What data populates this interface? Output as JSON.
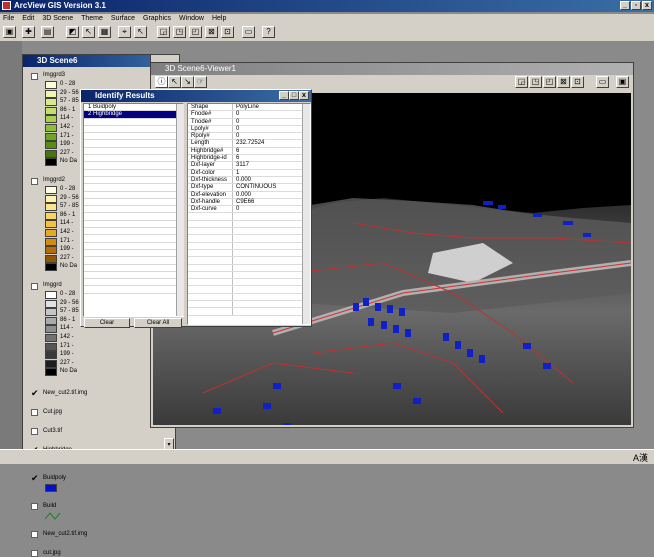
{
  "app": {
    "title": "ArcView GIS Version 3.1"
  },
  "menu": [
    "File",
    "Edit",
    "3D Scene",
    "Theme",
    "Surface",
    "Graphics",
    "Window",
    "Help"
  ],
  "scene": {
    "title": "3D Scene6"
  },
  "viewer": {
    "title": "3D Scene6-Viewer1"
  },
  "identify": {
    "title": "Identify Results",
    "list": [
      "1  Buidpoly",
      "2  Highbridge"
    ],
    "selected_index": 1,
    "clear_label": "Clear",
    "clear_all_label": "Clear All",
    "attributes": [
      [
        "Shape",
        "PolyLine"
      ],
      [
        "Fnode#",
        "0"
      ],
      [
        "Tnode#",
        "0"
      ],
      [
        "Lpoly#",
        "0"
      ],
      [
        "Rpoly#",
        "0"
      ],
      [
        "Length",
        "232.72524"
      ],
      [
        "Highbridge#",
        "6"
      ],
      [
        "Highbridge-id",
        "6"
      ],
      [
        "Dxf-layer",
        "3117"
      ],
      [
        "Dxf-color",
        "1"
      ],
      [
        "Dxf-thickness",
        "0.000"
      ],
      [
        "Dxf-type",
        "CONTINUOUS"
      ],
      [
        "Dxf-elevation",
        "0.000"
      ],
      [
        "Dxf-handle",
        "C9E66"
      ],
      [
        "Dxf-curve",
        "0"
      ]
    ]
  },
  "legend": {
    "themes": [
      {
        "name": "Imggrd3",
        "checked": false,
        "classes": [
          "0 - 28",
          "29 - 56",
          "57 - 85",
          "86 - 1",
          "114 -",
          "142 -",
          "171 -",
          "199 -",
          "227 -",
          "No Da"
        ],
        "colors": [
          "#fbfdd9",
          "#eef5b4",
          "#d9ea8c",
          "#c3df6a",
          "#a9d04c",
          "#8cbf33",
          "#6fa61f",
          "#588c12",
          "#477509",
          "#000000"
        ]
      },
      {
        "name": "Imggrd2",
        "checked": false,
        "classes": [
          "0 - 28",
          "29 - 56",
          "57 - 85",
          "86 - 1",
          "114 -",
          "142 -",
          "171 -",
          "199 -",
          "227 -",
          "No Da"
        ],
        "colors": [
          "#fffde0",
          "#fdf3b0",
          "#fbe588",
          "#f8d460",
          "#f4c23c",
          "#eaa81e",
          "#d48c0e",
          "#b36f06",
          "#915503",
          "#000000"
        ]
      },
      {
        "name": "Imggrd",
        "checked": false,
        "classes": [
          "0 - 28",
          "29 - 56",
          "57 - 85",
          "86 - 1",
          "114 -",
          "142 -",
          "171 -",
          "199 -",
          "227 -",
          "No Da"
        ],
        "colors": [
          "#ffffff",
          "#e2e2e2",
          "#c6c6c6",
          "#aaaaaa",
          "#8e8e8e",
          "#727272",
          "#565656",
          "#3a3a3a",
          "#1e1e1e",
          "#000000"
        ]
      }
    ],
    "layers": [
      {
        "name": "New_cut2.tif.img",
        "checked": true
      },
      {
        "name": "Cut.jpg",
        "checked": false
      },
      {
        "name": "Cut3.tif",
        "checked": false
      },
      {
        "name": "Highbridge",
        "checked": true
      },
      {
        "name": "Buidpoly",
        "checked": true
      },
      {
        "name": "Build",
        "checked": false
      },
      {
        "name": "New_cut2.tif.img",
        "checked": false
      },
      {
        "name": "cut.jpg",
        "checked": false
      }
    ]
  },
  "status": {
    "ime": "A漢"
  }
}
